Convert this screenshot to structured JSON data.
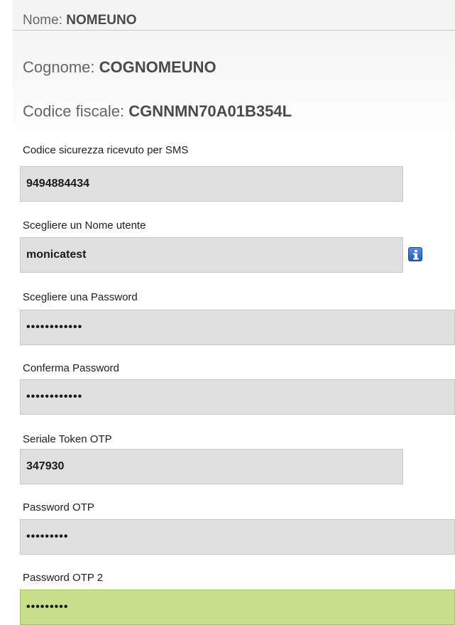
{
  "identity": {
    "nome": {
      "label": "Nome:",
      "value": "NOMEUNO"
    },
    "cognome": {
      "label": "Cognome:",
      "value": "COGNOMEUNO"
    },
    "codice_fiscale": {
      "label": "Codice fiscale:",
      "value": "CGNNMN70A01B354L"
    }
  },
  "form": {
    "sms_code": {
      "label": "Codice sicurezza ricevuto per SMS",
      "value": "9494884434"
    },
    "username": {
      "label": "Scegliere un Nome utente",
      "value": "monicatest",
      "info_icon": "info-icon"
    },
    "password": {
      "label": "Scegliere una Password",
      "value": "••••••••••••"
    },
    "confirm_password": {
      "label": "Conferma Password",
      "value": "••••••••••••"
    },
    "otp_serial": {
      "label": "Seriale Token OTP",
      "value": "347930"
    },
    "otp_password": {
      "label": "Password OTP",
      "value": "•••••••••"
    },
    "otp_password_2": {
      "label": "Password OTP 2",
      "value": "•••••••••"
    }
  },
  "colors": {
    "field_background": "#e0e0e0",
    "active_field_background": "#c9e08b",
    "info_icon": "#2a6fd0"
  }
}
